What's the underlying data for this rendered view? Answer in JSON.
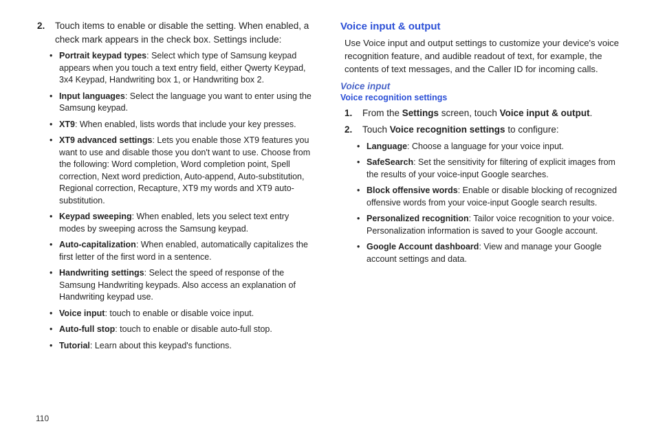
{
  "pageNumber": "110",
  "left": {
    "step2": {
      "num": "2.",
      "text": "Touch items to enable or disable the setting. When enabled, a check mark appears in the check box. Settings include:"
    },
    "bullets": [
      {
        "bold": "Portrait keypad types",
        "rest": ": Select which type of Samsung keypad appears when you touch a text entry field, either Qwerty Keypad, 3x4 Keypad, Handwriting box 1, or Handwriting box 2."
      },
      {
        "bold": "Input languages",
        "rest": ": Select the language you want to enter using the Samsung keypad."
      },
      {
        "bold": "XT9",
        "rest": ": When enabled, lists words that include your key presses."
      },
      {
        "bold": "XT9 advanced settings",
        "rest": ": Lets you enable those XT9 features you want to use and disable those you don't want to use. Choose from the following: Word completion, Word completion point, Spell correction, Next word prediction, Auto-append, Auto-substitution, Regional correction, Recapture, XT9 my words and XT9 auto-substitution."
      },
      {
        "bold": "Keypad sweeping",
        "rest": ": When enabled, lets you select text entry modes by sweeping across the Samsung keypad."
      },
      {
        "bold": "Auto-capitalization",
        "rest": ": When enabled, automatically capitalizes the first letter of the first word in a sentence."
      },
      {
        "bold": "Handwriting settings",
        "rest": ": Select the speed of response of the Samsung Handwriting keypads. Also access an explanation of Handwriting keypad use."
      },
      {
        "bold": "Voice input",
        "rest": ": touch to enable or disable voice input."
      },
      {
        "bold": "Auto-full stop",
        "rest": ": touch to enable or disable auto-full stop."
      },
      {
        "bold": "Tutorial",
        "rest": ": Learn about this keypad's functions."
      }
    ]
  },
  "right": {
    "heading": "Voice input & output",
    "intro": "Use Voice input and output settings to customize your device's voice recognition feature, and audible readout of text, for example, the contents of text messages, and the Caller ID for incoming calls.",
    "subItalic": "Voice input",
    "subHeading": "Voice recognition settings",
    "step1": {
      "num": "1.",
      "pre": "From the ",
      "b1": "Settings",
      "mid": " screen, touch ",
      "b2": "Voice input & output",
      "post": "."
    },
    "step2": {
      "num": "2.",
      "pre": "Touch ",
      "b1": "Voice recognition settings",
      "post": " to configure:"
    },
    "bullets": [
      {
        "bold": "Language",
        "rest": ": Choose a language for your voice input."
      },
      {
        "bold": "SafeSearch",
        "rest": ": Set the sensitivity for filtering of explicit images from the results of your voice-input Google searches."
      },
      {
        "bold": "Block offensive words",
        "rest": ": Enable or disable blocking of recognized offensive words from your voice-input Google search results."
      },
      {
        "bold": "Personalized recognition",
        "rest": ": Tailor voice recognition to your voice. Personalization information is saved to your Google account."
      },
      {
        "bold": "Google Account dashboard",
        "rest": ": View and manage your Google account settings and data."
      }
    ]
  }
}
